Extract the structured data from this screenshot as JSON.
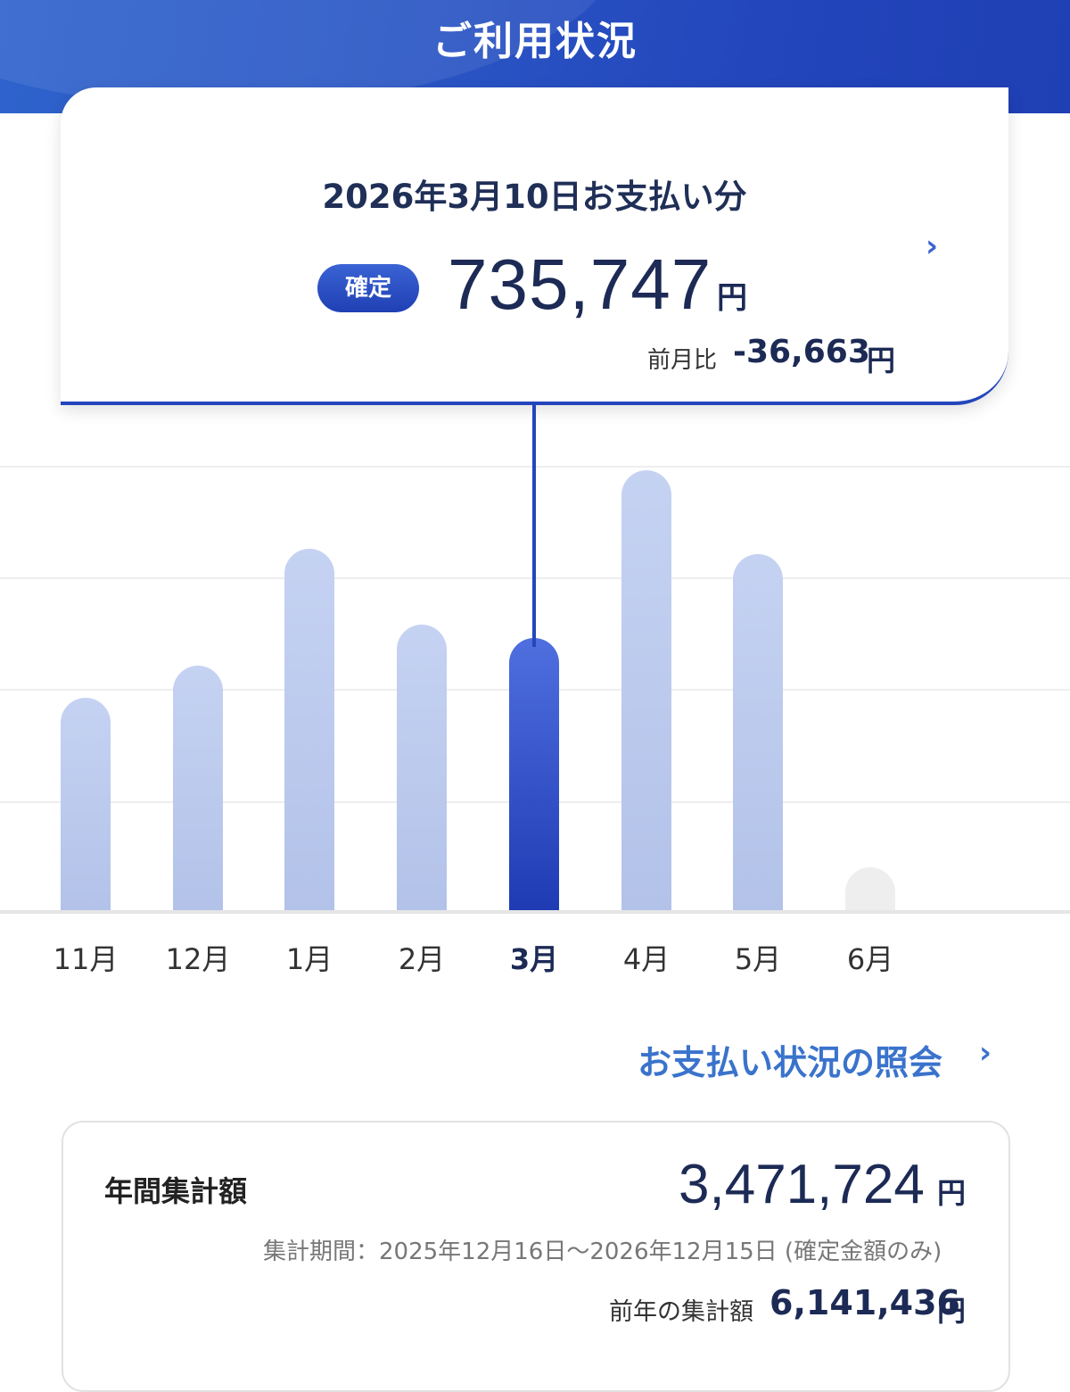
{
  "header": {
    "title": "ご利用状況"
  },
  "payment_card": {
    "date_label": "2026年3月10日お支払い分",
    "status_badge": "確定",
    "amount": "735,747",
    "currency": "円",
    "diff_label": "前月比",
    "diff_value": "-36,663",
    "diff_currency": "円",
    "chevron": "›"
  },
  "chart_data": {
    "type": "bar",
    "categories": [
      "11月",
      "12月",
      "1月",
      "2月",
      "3月",
      "4月",
      "5月",
      "6月"
    ],
    "values": [
      475,
      548,
      810,
      640,
      610,
      985,
      797,
      95
    ],
    "selected_index": 4,
    "future_index": 7,
    "ylim": [
      0,
      1000
    ],
    "colors": {
      "selected": "#2346bc",
      "normal": "#c1cef0",
      "future": "#eeeeee"
    }
  },
  "links": {
    "payment_inquiry": "お支払い状況の照会",
    "chevron": "›"
  },
  "annual": {
    "label": "年間集計額",
    "amount": "3,471,724",
    "currency": "円",
    "period": "集計期間：2025年12月16日〜2026年12月15日 (確定金額のみ)",
    "prev_label": "前年の集計額",
    "prev_value": "6,141,436",
    "prev_currency": "円"
  }
}
